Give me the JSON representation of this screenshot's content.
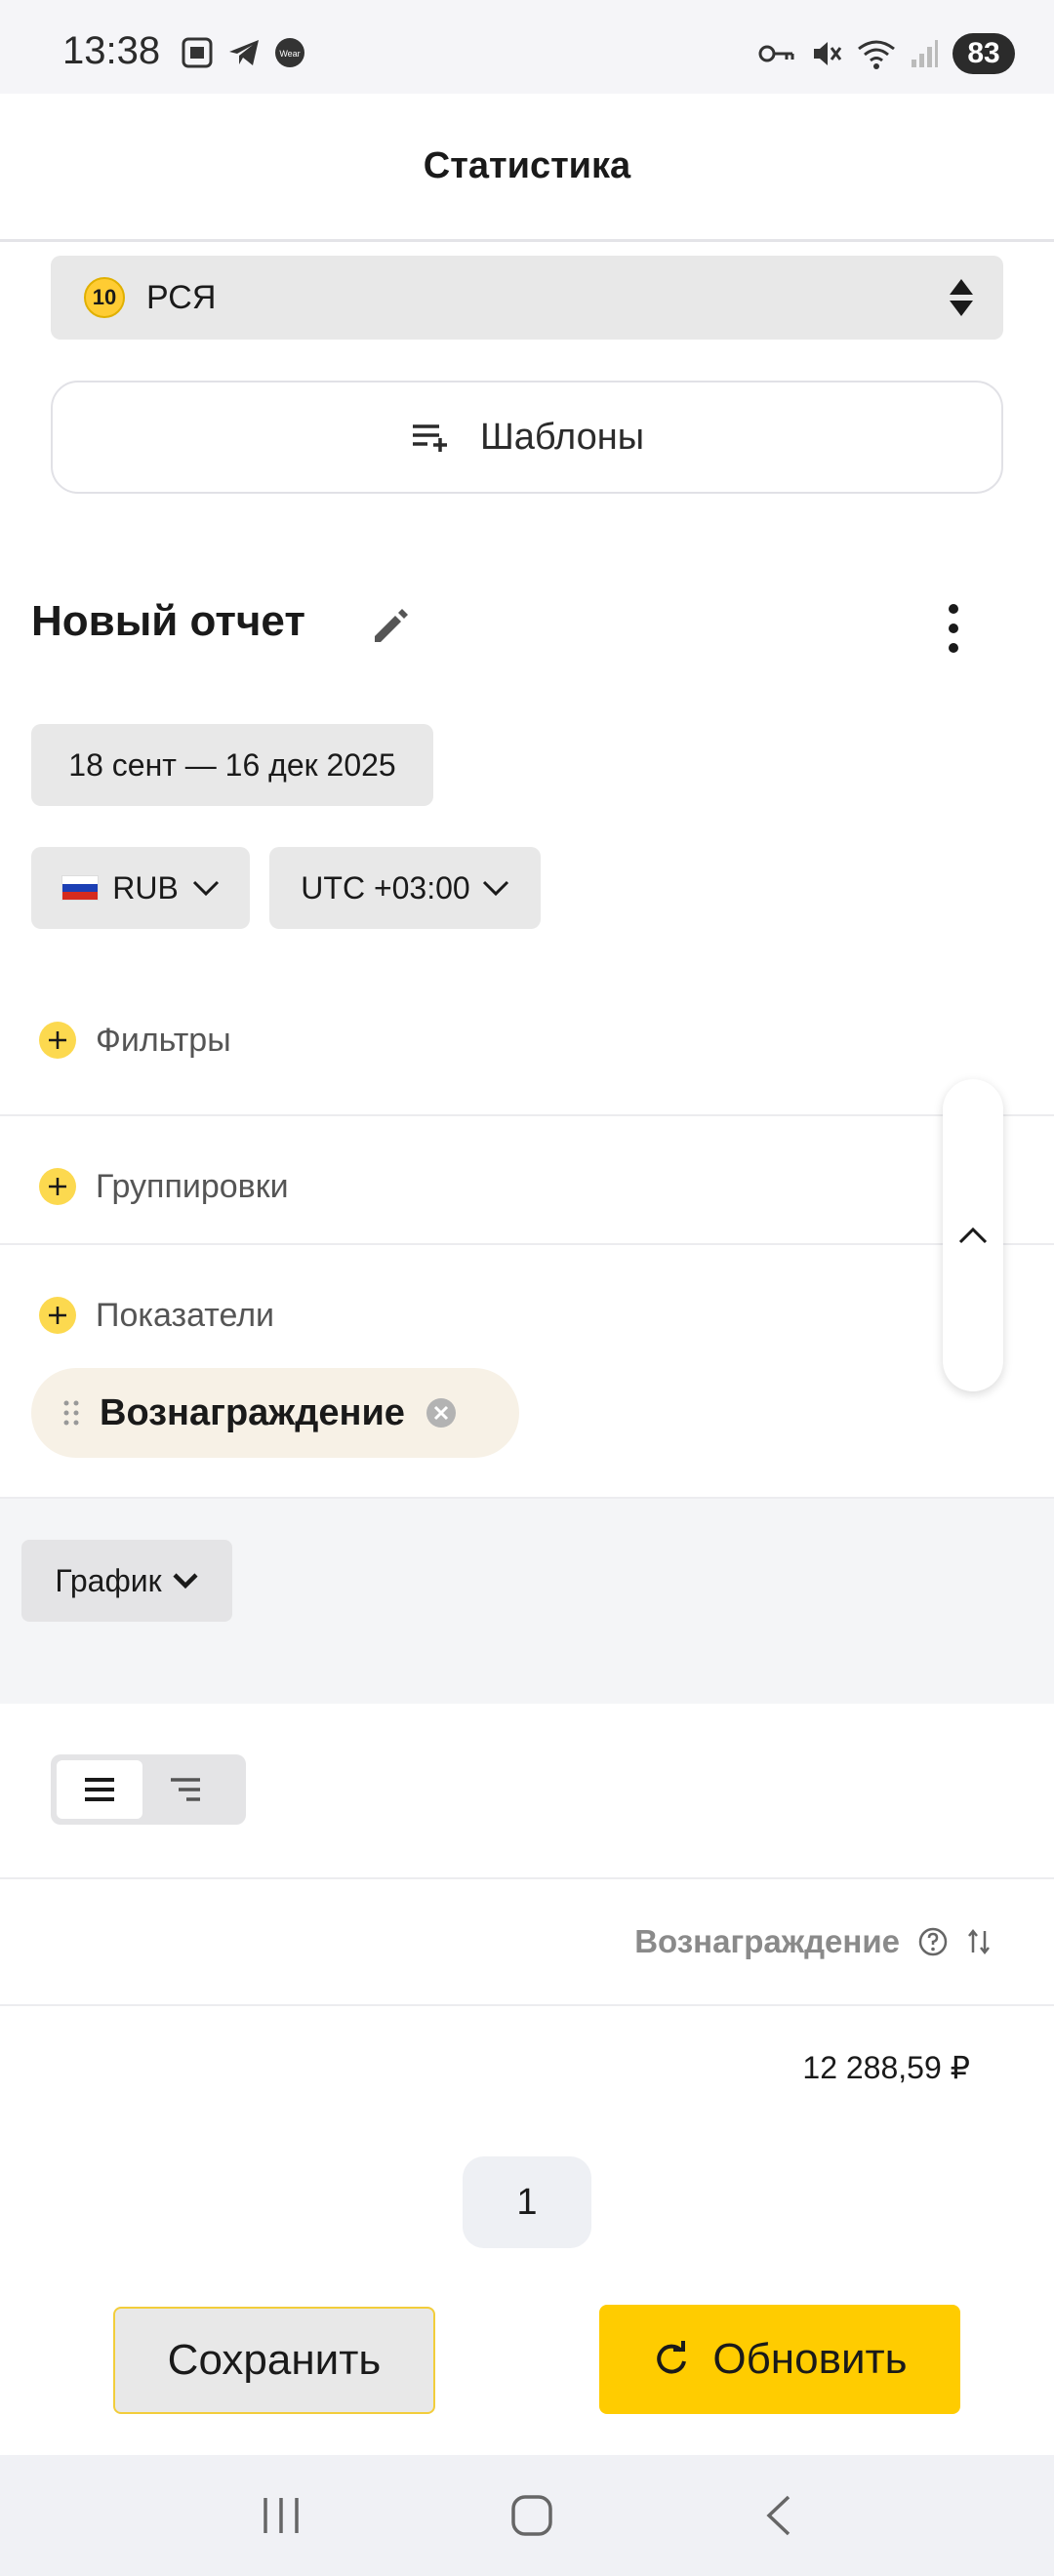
{
  "status_bar": {
    "time": "13:38",
    "battery": "83",
    "left_icons": [
      "screenshot-icon",
      "telegram-icon",
      "wear-icon"
    ],
    "right_icons": [
      "vpn-key-icon",
      "mute-icon",
      "wifi-icon",
      "signal-icon"
    ]
  },
  "app_bar": {
    "title": "Статистика"
  },
  "platform_select": {
    "badge": "10",
    "label": "РСЯ"
  },
  "templates_button": {
    "label": "Шаблоны"
  },
  "report": {
    "title": "Новый отчет"
  },
  "period": {
    "label": "18 сент — 16 дек 2025"
  },
  "currency": {
    "label": "RUB"
  },
  "timezone": {
    "label": "UTC +03:00"
  },
  "sections": {
    "filters": "Фильтры",
    "groupings": "Группировки",
    "metrics": "Показатели"
  },
  "metric_chip": {
    "label": "Вознаграждение"
  },
  "chart_selector": {
    "label": "График"
  },
  "table": {
    "columns": [
      "Вознаграждение"
    ],
    "rows": [
      [
        "12 288,59 ₽"
      ]
    ]
  },
  "pagination": {
    "current_page": "1"
  },
  "actions": {
    "save_label": "Сохранить",
    "refresh_label": "Обновить"
  },
  "colors": {
    "accent": "#ffcc00",
    "plus_icon": "#fcd94f",
    "chip_bg": "#e8e8e8"
  }
}
